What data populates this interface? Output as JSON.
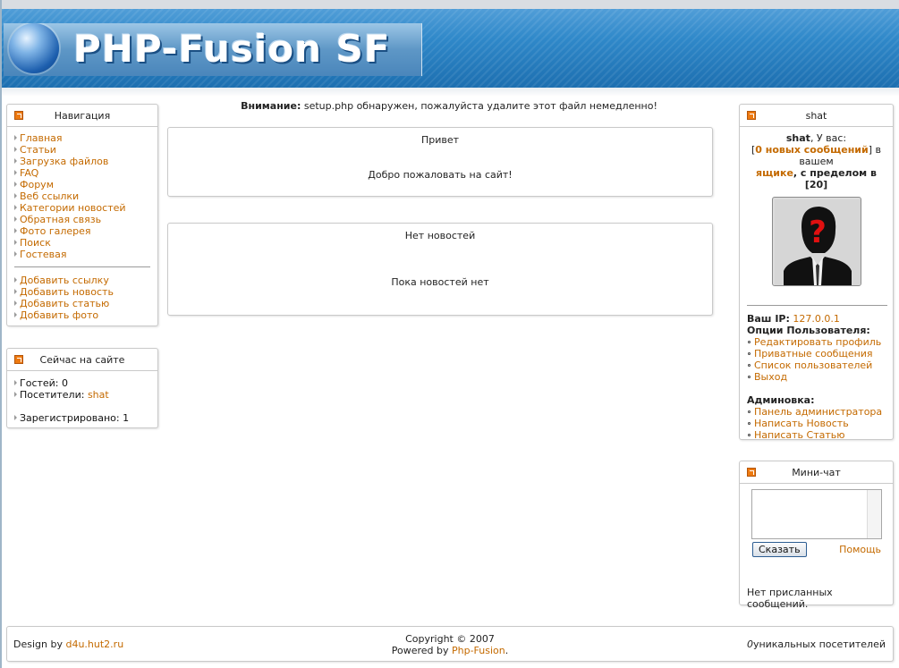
{
  "header": {
    "logo_text": "PHP-Fusion SF"
  },
  "navigation": {
    "title": "Навигация",
    "items": [
      "Главная",
      "Статьи",
      "Загрузка файлов",
      "FAQ",
      "Форум",
      "Веб ссылки",
      "Категории новостей",
      "Обратная связь",
      "Фото галерея",
      "Поиск",
      "Гостевая"
    ],
    "submit_items": [
      "Добавить ссылку",
      "Добавить новость",
      "Добавить статью",
      "Добавить фото"
    ]
  },
  "online": {
    "title": "Сейчас на сайте",
    "guests_label": "Гостей:",
    "guests_value": "0",
    "visitors_label": "Посетители:",
    "visitors_value": "shat",
    "registered_label": "Зарегистрировано:",
    "registered_value": "1"
  },
  "notice": {
    "bold": "Внимание:",
    "text": " setup.php обнаружен, пожалуйста удалите этот файл немедленно!"
  },
  "welcome": {
    "title": "Привет",
    "body": "Добро пожаловать на сайт!"
  },
  "news": {
    "title": "Нет новостей",
    "body": "Пока новостей нет"
  },
  "user": {
    "title": "shat",
    "username": "shat",
    "have_text": ", У вас:",
    "bracket_open": "[",
    "messages_link": "0 новых сообщений",
    "bracket_close": "] в вашем",
    "box_link": "ящике",
    "limit_text": ", с пределом в [20]",
    "ip_label": "Ваш IP:",
    "ip_value": "127.0.0.1",
    "options_label": "Опции Пользователя:",
    "options": [
      "Редактировать профиль",
      "Приватные сообщения",
      "Список пользователей",
      "Выход"
    ],
    "admin_label": "Админовка:",
    "admin_links": [
      "Панель администратора",
      "Написать Новость",
      "Написать Статью"
    ]
  },
  "chat": {
    "title": "Мини-чат",
    "button": "Сказать",
    "help": "Помощь",
    "empty": "Нет присланных сообщений."
  },
  "footer": {
    "design_by": "Design by",
    "design_link": "d4u.hut2.ru",
    "copyright": "Copyright © 2007",
    "powered_by": "Powered by",
    "powered_link": "Php-Fusion",
    "powered_dot": ".",
    "unique_count": "0",
    "unique_text": "уникальных посетителей"
  },
  "colors": {
    "link": "#c46a00",
    "header_blue": "#2f88c9",
    "panel_border": "#c9c9c9"
  }
}
